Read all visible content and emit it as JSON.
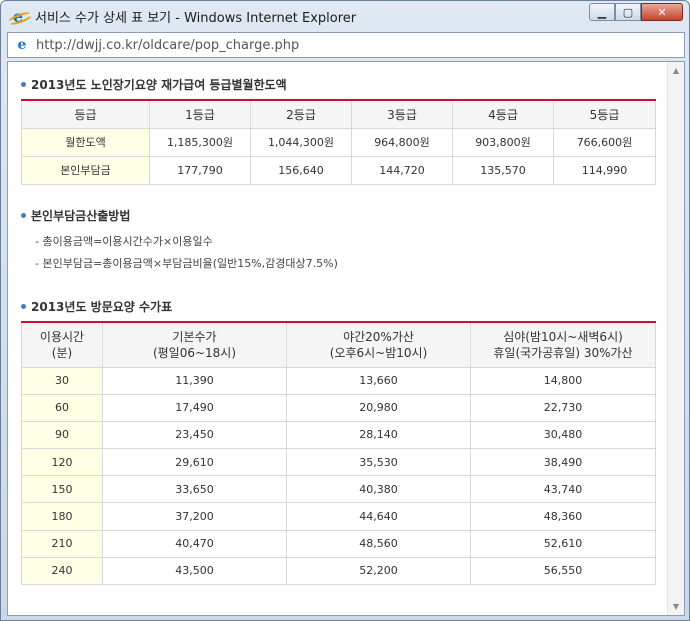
{
  "window": {
    "title": "서비스 수가 상세 표 보기 - Windows Internet Explorer",
    "url": "http://dwjj.co.kr/oldcare/pop_charge.php"
  },
  "section1": {
    "title": "2013년도 노인장기요양 재가급여 등급별월한도액",
    "headers": [
      "등급",
      "1등급",
      "2등급",
      "3등급",
      "4등급",
      "5등급"
    ],
    "rows": [
      [
        "월한도액",
        "1,185,300원",
        "1,044,300원",
        "964,800원",
        "903,800원",
        "766,600원"
      ],
      [
        "본인부담금",
        "177,790",
        "156,640",
        "144,720",
        "135,570",
        "114,990"
      ]
    ]
  },
  "section2": {
    "title": "본인부담금산출방법",
    "lines": [
      "- 총이용금액=이용시간수가×이용일수",
      "- 본인부담금=총이용금액×부담금비율(일반15%,감경대상7.5%)"
    ]
  },
  "section3": {
    "title": "2013년도 방문요양 수가표",
    "headers": [
      [
        "이용시간",
        "(분)"
      ],
      [
        "기본수가",
        "(평일06~18시)"
      ],
      [
        "야간20%가산",
        "(오후6시~밤10시)"
      ],
      [
        "심야(밤10시~새벽6시)",
        "휴일(국가공휴일) 30%가산"
      ]
    ],
    "rows": [
      [
        "30",
        "11,390",
        "13,660",
        "14,800"
      ],
      [
        "60",
        "17,490",
        "20,980",
        "22,730"
      ],
      [
        "90",
        "23,450",
        "28,140",
        "30,480"
      ],
      [
        "120",
        "29,610",
        "35,530",
        "38,490"
      ],
      [
        "150",
        "33,650",
        "40,380",
        "43,740"
      ],
      [
        "180",
        "37,200",
        "44,640",
        "48,360"
      ],
      [
        "210",
        "40,470",
        "48,560",
        "52,610"
      ],
      [
        "240",
        "43,500",
        "52,200",
        "56,550"
      ]
    ]
  }
}
